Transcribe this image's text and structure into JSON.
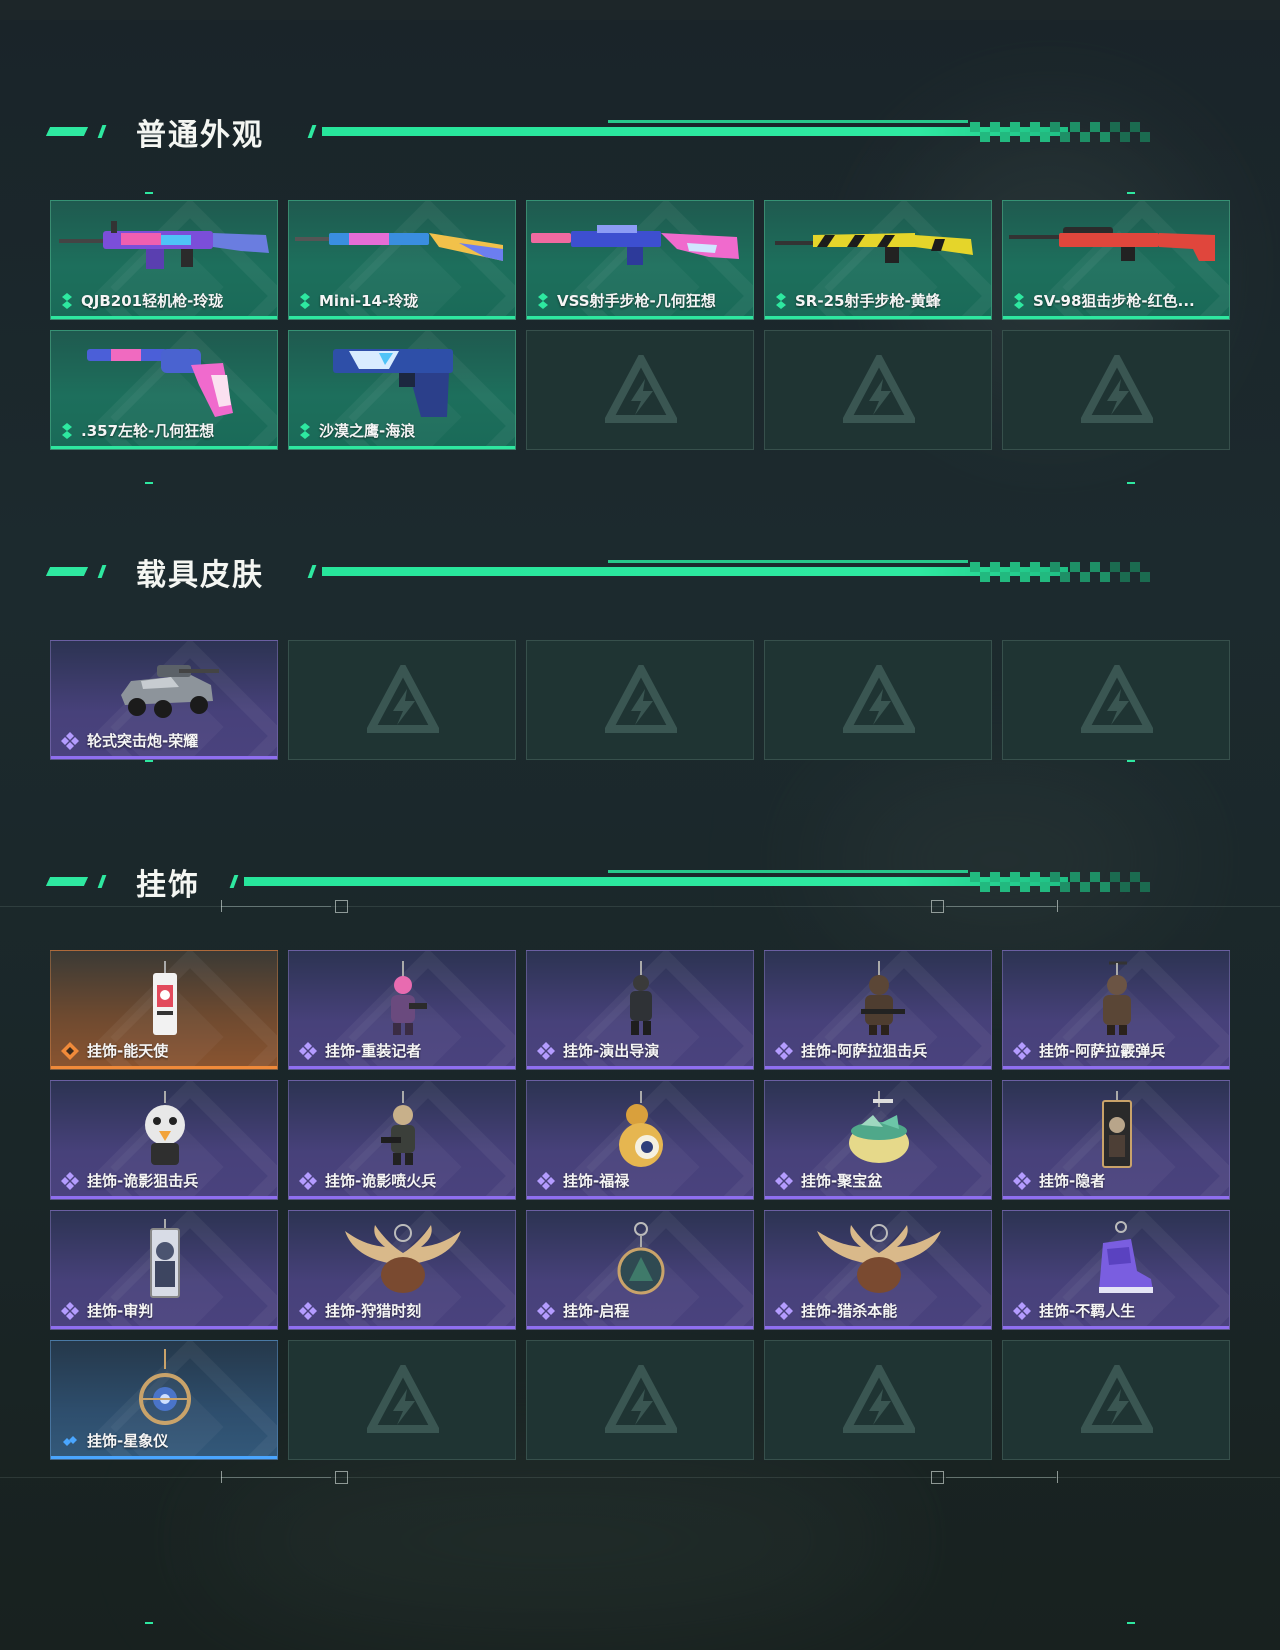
{
  "sections": {
    "weapons": {
      "title": "普通外观",
      "items": [
        {
          "label": "QJB201轻机枪-玲珑",
          "rarity": "green"
        },
        {
          "label": "Mini-14-玲珑",
          "rarity": "green"
        },
        {
          "label": "VSS射手步枪-几何狂想",
          "rarity": "green"
        },
        {
          "label": "SR-25射手步枪-黄蜂",
          "rarity": "green"
        },
        {
          "label": "SV-98狙击步枪-红色...",
          "rarity": "green"
        },
        {
          "label": ".357左轮-几何狂想",
          "rarity": "green"
        },
        {
          "label": "沙漠之鹰-海浪",
          "rarity": "green"
        }
      ]
    },
    "vehicles": {
      "title": "载具皮肤",
      "items": [
        {
          "label": "轮式突击炮-荣耀",
          "rarity": "purple"
        }
      ]
    },
    "charms": {
      "title": "挂饰",
      "items": [
        {
          "label": "挂饰-能天使",
          "rarity": "orange"
        },
        {
          "label": "挂饰-重装记者",
          "rarity": "purple"
        },
        {
          "label": "挂饰-演出导演",
          "rarity": "purple"
        },
        {
          "label": "挂饰-阿萨拉狙击兵",
          "rarity": "purple"
        },
        {
          "label": "挂饰-阿萨拉霰弹兵",
          "rarity": "purple"
        },
        {
          "label": "挂饰-诡影狙击兵",
          "rarity": "purple"
        },
        {
          "label": "挂饰-诡影喷火兵",
          "rarity": "purple"
        },
        {
          "label": "挂饰-福禄",
          "rarity": "purple"
        },
        {
          "label": "挂饰-聚宝盆",
          "rarity": "purple"
        },
        {
          "label": "挂饰-隐者",
          "rarity": "purple"
        },
        {
          "label": "挂饰-审判",
          "rarity": "purple"
        },
        {
          "label": "挂饰-狩猎时刻",
          "rarity": "purple"
        },
        {
          "label": "挂饰-启程",
          "rarity": "purple"
        },
        {
          "label": "挂饰-猎杀本能",
          "rarity": "purple"
        },
        {
          "label": "挂饰-不羁人生",
          "rarity": "purple"
        },
        {
          "label": "挂饰-星象仪",
          "rarity": "blue"
        }
      ]
    }
  },
  "colors": {
    "accent": "#2ee8a0",
    "green": "#2ee8a0",
    "purple": "#8f6ff0",
    "orange": "#f08a3a",
    "blue": "#4aa6ff"
  }
}
